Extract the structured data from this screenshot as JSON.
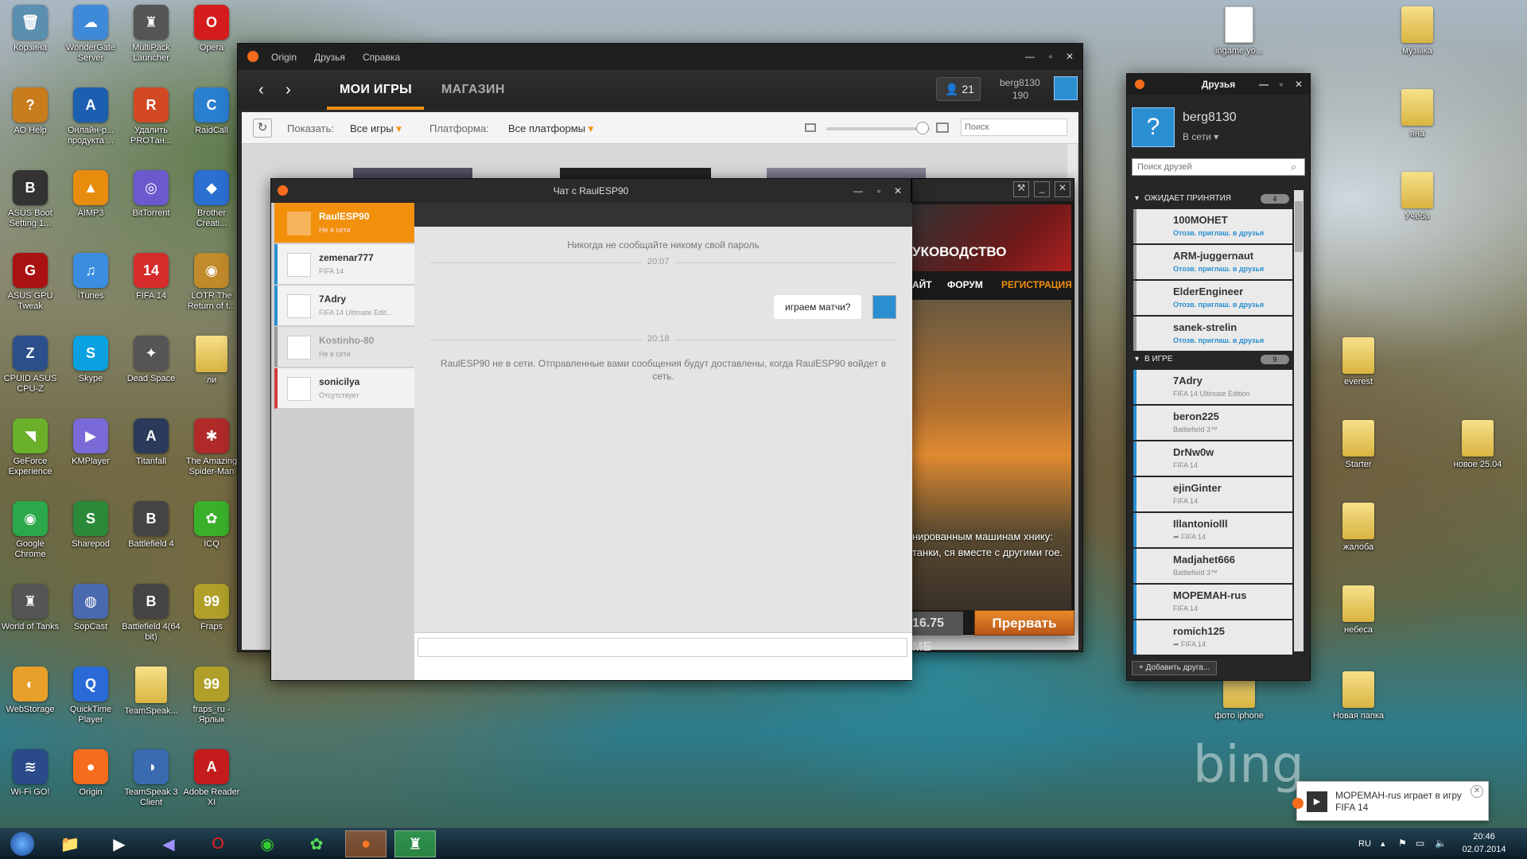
{
  "desktop": {
    "icons": [
      {
        "label": "Корзина",
        "glyph": "🗑",
        "color": "#5a8fb0"
      },
      {
        "label": "WonderGate Server",
        "glyph": "☁",
        "color": "#3f8ad8"
      },
      {
        "label": "MultiPack Launcher",
        "glyph": "♜",
        "color": "#555"
      },
      {
        "label": "Opera",
        "glyph": "O",
        "color": "#d51c1c"
      },
      {
        "label": "AO Help",
        "glyph": "?",
        "color": "#c97c1c"
      },
      {
        "label": "Онлайн-р... продукта ...",
        "glyph": "A",
        "color": "#1c5fb0"
      },
      {
        "label": "Удалить PROTан...",
        "glyph": "R",
        "color": "#d34a22"
      },
      {
        "label": "RaidCall",
        "glyph": "C",
        "color": "#2a7fd1"
      },
      {
        "label": "ASUS Boot Setting 1...",
        "glyph": "B",
        "color": "#333"
      },
      {
        "label": "AIMP3",
        "glyph": "▲",
        "color": "#e88c0e"
      },
      {
        "label": "BitTorrent",
        "glyph": "◎",
        "color": "#6a5acd"
      },
      {
        "label": "Brother Creati...",
        "glyph": "◆",
        "color": "#2a6fd1"
      },
      {
        "label": "ASUS GPU Tweak",
        "glyph": "G",
        "color": "#a11"
      },
      {
        "label": "iTunes",
        "glyph": "♫",
        "color": "#3a8de0"
      },
      {
        "label": "FIFA 14",
        "glyph": "14",
        "color": "#d62b2b"
      },
      {
        "label": "LOTR The Return of t...",
        "glyph": "◉",
        "color": "#c18a2a"
      },
      {
        "label": "CPUID ASUS CPU-Z",
        "glyph": "Z",
        "color": "#2a4f8a"
      },
      {
        "label": "Skype",
        "glyph": "S",
        "color": "#0aa1e0"
      },
      {
        "label": "Dead Space",
        "glyph": "✦",
        "color": "#555"
      },
      {
        "label": "ли",
        "glyph": "",
        "color": "folder"
      },
      {
        "label": "GeForce Experience",
        "glyph": "◥",
        "color": "#6ab02a"
      },
      {
        "label": "KMPlayer",
        "glyph": "▶",
        "color": "#7a6ad8"
      },
      {
        "label": "Titanfall",
        "glyph": "A",
        "color": "#2a3a5a"
      },
      {
        "label": "The Amazing Spider-Man",
        "glyph": "✱",
        "color": "#b02a2a"
      },
      {
        "label": "Google Chrome",
        "glyph": "◉",
        "color": "#2aa84a"
      },
      {
        "label": "Sharepod",
        "glyph": "S",
        "color": "#2a8a3a"
      },
      {
        "label": "Battlefield 4",
        "glyph": "B",
        "color": "#444"
      },
      {
        "label": "ICQ",
        "glyph": "✿",
        "color": "#3ab02a"
      },
      {
        "label": "World of Tanks",
        "glyph": "♜",
        "color": "#555"
      },
      {
        "label": "SopCast",
        "glyph": "◍",
        "color": "#4a6ab0"
      },
      {
        "label": "Battlefield 4(64 bit)",
        "glyph": "B",
        "color": "#444"
      },
      {
        "label": "Fraps",
        "glyph": "99",
        "color": "#b0a02a"
      },
      {
        "label": "WebStorage",
        "glyph": "◐",
        "color": "#e8a02a"
      },
      {
        "label": "QuickTime Player",
        "glyph": "Q",
        "color": "#2a6ad8"
      },
      {
        "label": "TeamSpeak...",
        "glyph": "",
        "color": "folder"
      },
      {
        "label": "fraps_ru - Ярлык",
        "glyph": "99",
        "color": "#b0a02a"
      },
      {
        "label": "Wi-Fi GO!",
        "glyph": "≋",
        "color": "#2a4a8a"
      },
      {
        "label": "Origin",
        "glyph": "●",
        "color": "#f56c1c"
      },
      {
        "label": "TeamSpeak 3 Client",
        "glyph": "◑",
        "color": "#3a6ab0"
      },
      {
        "label": "Adobe Reader XI",
        "glyph": "A",
        "color": "#c41c1c"
      }
    ],
    "right_icons": [
      {
        "label": "ingame yo...",
        "kind": "doc"
      },
      {
        "label": "музыка",
        "kind": "folder"
      },
      {
        "label": "яна",
        "kind": "folder"
      },
      {
        "label": "Учёба",
        "kind": "folder"
      },
      {
        "label": "everest",
        "kind": "folder"
      },
      {
        "label": "Starter",
        "kind": "folder"
      },
      {
        "label": "новое 25.04",
        "kind": "folder"
      },
      {
        "label": "жалоба",
        "kind": "folder"
      },
      {
        "label": "небеса",
        "kind": "folder"
      },
      {
        "label": "фото iphone",
        "kind": "folder"
      },
      {
        "label": "Новая папка",
        "kind": "folder"
      }
    ],
    "watermark": "bing"
  },
  "origin": {
    "menu": [
      "Origin",
      "Друзья",
      "Справка"
    ],
    "tabs": [
      "МОИ ИГРЫ",
      "МАГАЗИН"
    ],
    "friends_count": "21",
    "username": "berg8130",
    "points": "190",
    "toolbar": {
      "show_label": "Показать:",
      "show_value": "Все игры",
      "platform_label": "Платформа:",
      "platform_value": "Все платформы",
      "search_placeholder": "Поиск"
    }
  },
  "game_panel": {
    "banner": "УКОВОДСТВО",
    "links": [
      "АЙТ",
      "ФОРУМ",
      "РЕГИСТРАЦИЯ"
    ],
    "text": "нированным машинам хнику: танки, ся вместе с другими гое.",
    "size": "16.75 МБ",
    "cancel": "Прервать"
  },
  "chat": {
    "title": "Чат с RaulESP90",
    "contacts": [
      {
        "name": "RaulESP90",
        "status": "Не в сети",
        "active": true,
        "color": "#f2900c"
      },
      {
        "name": "zemenar777",
        "status": "FIFA 14",
        "color": "#2a8fd1"
      },
      {
        "name": "7Adry",
        "status": "FIFA 14 Ultimate Edit...",
        "color": "#2a8fd1"
      },
      {
        "name": "Kostinho-80",
        "status": "Не в сети",
        "color": "#999"
      },
      {
        "name": "sonicilya",
        "status": "Отсутствует",
        "color": "#d13a3a"
      }
    ],
    "warning": "Никогда не сообщайте никому свой пароль",
    "time1": "20:07",
    "message": "играем матчи?",
    "time2": "20:18",
    "offline_note": "RaulESP90 не в сети. Отправленные вами сообщения будут доставлены, когда RaulESP90 войдет в сеть."
  },
  "friends": {
    "title": "Друзья",
    "username": "berg8130",
    "status": "В сети",
    "search_placeholder": "Поиск друзей",
    "group_pending": {
      "label": "ОЖИДАЕТ ПРИНЯТИЯ",
      "count": "4",
      "items": [
        {
          "name": "100MOHET",
          "status": "Отозв. приглаш. в друзья"
        },
        {
          "name": "ARM-juggernaut",
          "status": "Отозв. приглаш. в друзья"
        },
        {
          "name": "ElderEngineer",
          "status": "Отозв. приглаш. в друзья"
        },
        {
          "name": "sanek-strelin",
          "status": "Отозв. приглаш. в друзья"
        }
      ]
    },
    "group_ingame": {
      "label": "В ИГРЕ",
      "count": "9",
      "items": [
        {
          "name": "7Adry",
          "status": "FIFA 14 Ultimate Edition"
        },
        {
          "name": "beron225",
          "status": "Battlefield 3™"
        },
        {
          "name": "DrNw0w",
          "status": "FIFA 14"
        },
        {
          "name": "ejinGinter",
          "status": "FIFA 14"
        },
        {
          "name": "Illantoniolll",
          "status": "➦ FIFA 14"
        },
        {
          "name": "Madjahet666",
          "status": "Battlefield 3™"
        },
        {
          "name": "MOPEMAH-rus",
          "status": "FIFA 14"
        },
        {
          "name": "romich125",
          "status": "➦ FIFA 14"
        }
      ]
    },
    "add_button": "+ Добавить друга..."
  },
  "notification": {
    "text": "MOPEMAH-rus играет в игру FIFA 14"
  },
  "taskbar": {
    "lang": "RU",
    "time": "20:46",
    "date": "02.07.2014"
  }
}
